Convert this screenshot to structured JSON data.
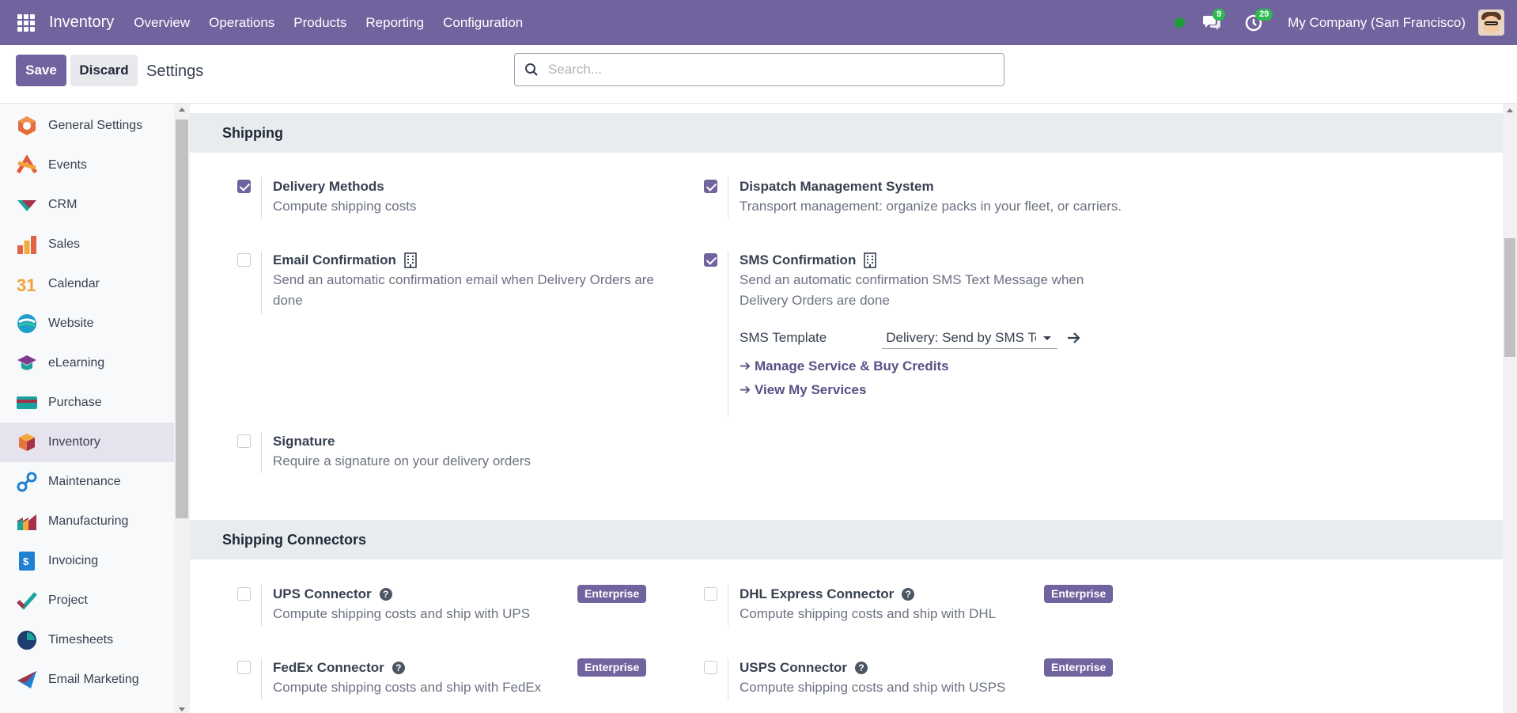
{
  "topbar": {
    "app_name": "Inventory",
    "menu": [
      "Overview",
      "Operations",
      "Products",
      "Reporting",
      "Configuration"
    ],
    "messages_count": "9",
    "activities_count": "29",
    "company": "My Company (San Francisco)"
  },
  "control": {
    "save_label": "Save",
    "discard_label": "Discard",
    "title": "Settings",
    "search_placeholder": "Search..."
  },
  "sidebar": {
    "items": [
      {
        "label": "General Settings",
        "icon": "general-settings-icon"
      },
      {
        "label": "Events",
        "icon": "events-icon"
      },
      {
        "label": "CRM",
        "icon": "crm-icon"
      },
      {
        "label": "Sales",
        "icon": "sales-icon"
      },
      {
        "label": "Calendar",
        "icon": "calendar-icon"
      },
      {
        "label": "Website",
        "icon": "website-icon"
      },
      {
        "label": "eLearning",
        "icon": "elearning-icon"
      },
      {
        "label": "Purchase",
        "icon": "purchase-icon"
      },
      {
        "label": "Inventory",
        "icon": "inventory-icon",
        "active": true
      },
      {
        "label": "Maintenance",
        "icon": "maintenance-icon"
      },
      {
        "label": "Manufacturing",
        "icon": "manufacturing-icon"
      },
      {
        "label": "Invoicing",
        "icon": "invoicing-icon"
      },
      {
        "label": "Project",
        "icon": "project-icon"
      },
      {
        "label": "Timesheets",
        "icon": "timesheets-icon"
      },
      {
        "label": "Email Marketing",
        "icon": "email-marketing-icon"
      }
    ],
    "calendar_number": "31"
  },
  "shipping": {
    "title": "Shipping",
    "delivery_methods": {
      "title": "Delivery Methods",
      "desc": "Compute shipping costs",
      "checked": true
    },
    "dispatch": {
      "title": "Dispatch Management System",
      "desc": "Transport management: organize packs in your fleet, or carriers.",
      "checked": true
    },
    "email_conf": {
      "title": "Email Confirmation",
      "desc1": "Send an automatic confirmation email when Delivery Orders are",
      "desc2": "done",
      "checked": false
    },
    "sms_conf": {
      "title": "SMS Confirmation",
      "desc1": "Send an automatic confirmation SMS Text Message when",
      "desc2": "Delivery Orders are done",
      "checked": true,
      "template_label": "SMS Template",
      "template_value": "Delivery: Send by SMS Text Message",
      "manage_link": "Manage Service & Buy Credits",
      "view_link": "View My Services"
    },
    "signature": {
      "title": "Signature",
      "desc": "Require a signature on your delivery orders",
      "checked": false
    }
  },
  "connectors": {
    "title": "Shipping Connectors",
    "enterprise_label": "Enterprise",
    "ups": {
      "title": "UPS Connector",
      "desc": "Compute shipping costs and ship with UPS"
    },
    "dhl": {
      "title": "DHL Express Connector",
      "desc": "Compute shipping costs and ship with DHL"
    },
    "fedex": {
      "title": "FedEx Connector",
      "desc": "Compute shipping costs and ship with FedEx"
    },
    "usps": {
      "title": "USPS Connector",
      "desc": "Compute shipping costs and ship with USPS"
    }
  },
  "colors": {
    "brand": "#71639e",
    "link": "#5b4f86",
    "badge_green": "#2dbb4f"
  }
}
